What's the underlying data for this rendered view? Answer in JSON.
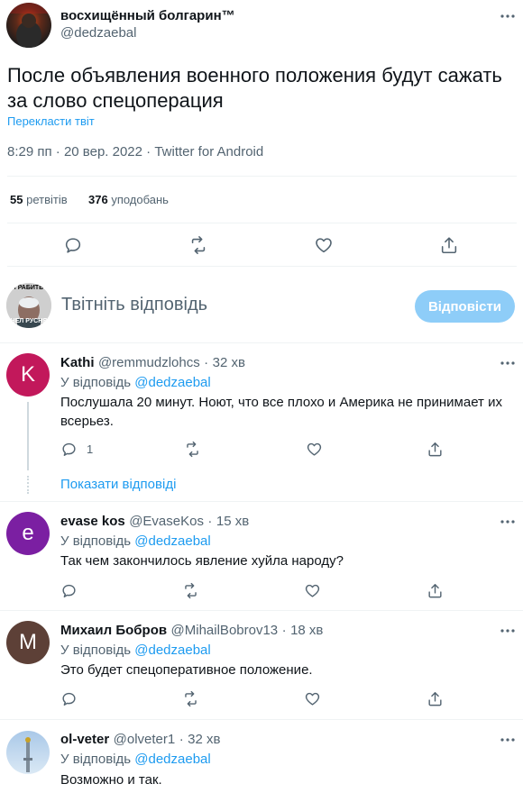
{
  "tweet": {
    "author_name": "восхищённый болгарин™",
    "author_handle": "@dedzaebal",
    "text_line1": "После объявления военного положения будут сажать",
    "text_line2": "за слово спецоперация",
    "translate_label": "Перекласти твіт",
    "time": "8:29 пп",
    "dot": "·",
    "date": "20 вер. 2022",
    "client": "Twitter for Android",
    "retweets_count": "55",
    "retweets_label": "ретвітів",
    "likes_count": "376",
    "likes_label": "уподобань"
  },
  "composer": {
    "placeholder": "Твітніть відповідь",
    "reply_button": "Відповісти",
    "avatar_caption_top": "ГРАБИТЬ",
    "avatar_caption_bottom": "НЕЛ РУСНЯ"
  },
  "replies": [
    {
      "name": "Kathi",
      "handle": "@remmudzlohcs",
      "time": "32 хв",
      "avatar_letter": "K",
      "avatar_color": "#c2185b",
      "reply_to_prefix": "У відповідь",
      "reply_to_handle": "@dedzaebal",
      "text_line1": "Послушала 20 минут. Ноют, что все плохо и Америка не принимает их",
      "text_line2": "всерьез.",
      "reply_count": "1",
      "show_replies": "Показати відповіді"
    },
    {
      "name": "evase kos",
      "handle": "@EvaseKos",
      "time": "15 хв",
      "avatar_letter": "e",
      "avatar_color": "#7b1fa2",
      "reply_to_prefix": "У відповідь",
      "reply_to_handle": "@dedzaebal",
      "text_line1": "Так чем закончилось явление хуйла народу?"
    },
    {
      "name": "Михаил Бобров",
      "handle": "@MihailBobrov13",
      "time": "18 хв",
      "avatar_letter": "M",
      "avatar_color": "#5d4037",
      "reply_to_prefix": "У відповідь",
      "reply_to_handle": "@dedzaebal",
      "text_line1": "Это будет спецоперативное положение."
    },
    {
      "name": "ol-veter",
      "handle": "@olveter1",
      "time": "32 хв",
      "reply_to_prefix": "У відповідь",
      "reply_to_handle": "@dedzaebal",
      "text_line1": "Возможно и так."
    }
  ],
  "colors": {
    "accent": "#1d9bf0",
    "button_disabled": "#8ecdf8",
    "muted": "#536471",
    "divider": "#eff3f4"
  },
  "icons": [
    "more-icon",
    "reply-icon",
    "retweet-icon",
    "like-icon",
    "share-icon"
  ]
}
